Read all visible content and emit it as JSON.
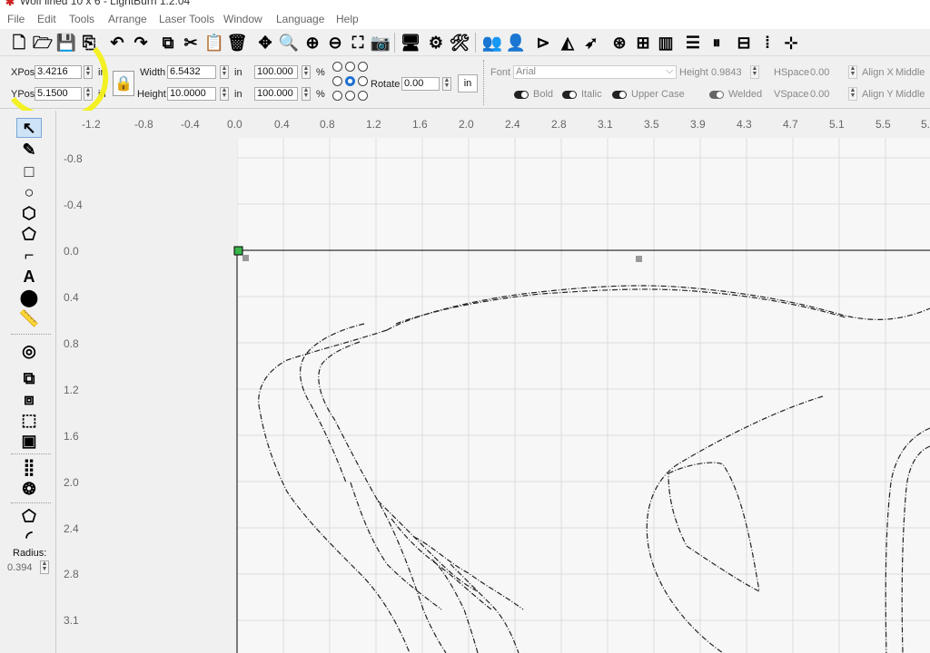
{
  "window": {
    "title": "Wolf lined 10 x 6 - LightBurn 1.2.04"
  },
  "menu": [
    "File",
    "Edit",
    "Tools",
    "Arrange",
    "Laser Tools",
    "Window",
    "Language",
    "Help"
  ],
  "toolbar_icons": [
    "new-file",
    "open-folder",
    "save",
    "save-as",
    "undo",
    "redo",
    "copy",
    "cut",
    "paste",
    "delete",
    "move",
    "zoom-in",
    "zoom-in",
    "zoom-out",
    "zoom-frame",
    "camera",
    "monitor",
    "settings",
    "tools",
    "group",
    "user",
    "mirror",
    "flip",
    "send",
    "target",
    "align",
    "distribute",
    "align-center",
    "align-middle",
    "dock",
    "distribute-grid"
  ],
  "props": {
    "xpos_label": "XPos",
    "xpos": "3.4216",
    "ypos_label": "YPos",
    "ypos": "5.1500",
    "unit": "in",
    "width_label": "Width",
    "width": "6.5432",
    "height_label": "Height",
    "height": "10.0000",
    "scale_w": "100.000",
    "scale_h": "100.000",
    "percent": "%",
    "rotate_label": "Rotate",
    "rotate": "0.00",
    "unit_btn": "in"
  },
  "text_props": {
    "font_label": "Font",
    "font": "Arial",
    "height_label": "Height",
    "height": "0.9843",
    "hspace_label": "HSpace",
    "hspace": "0.00",
    "vspace_label": "VSpace",
    "vspace": "0.00",
    "alignx_label": "Align X",
    "alignx": "Middle",
    "aligny_label": "Align Y",
    "aligny": "Middle",
    "bold": "Bold",
    "italic": "Italic",
    "upper": "Upper Case",
    "welded": "Welded"
  },
  "left_tools": [
    "select",
    "edit-nodes",
    "rectangle",
    "ellipse",
    "polygon",
    "pentagon",
    "frame",
    "text",
    "position",
    "measure",
    "offset",
    "boolean-union",
    "boolean-subtract",
    "boolean-intersect",
    "weld",
    "grid-array",
    "circular-array",
    "corner-radius",
    "corner-round"
  ],
  "radius": {
    "label": "Radius:",
    "value": "0.394"
  },
  "ruler_top": [
    "-1.2",
    "-0.8",
    "-0.4",
    "0.0",
    "0.4",
    "0.8",
    "1.2",
    "1.6",
    "2.0",
    "2.4",
    "2.8",
    "3.1",
    "3.5",
    "3.9",
    "4.3",
    "4.7",
    "5.1",
    "5.5",
    "5."
  ],
  "ruler_left": [
    "-0.8",
    "-0.4",
    "0.0",
    "0.4",
    "0.8",
    "1.2",
    "1.6",
    "2.0",
    "2.4",
    "2.8",
    "3.1"
  ],
  "colors": {
    "highlight": "#f4f21a",
    "accent": "#1f6fd1",
    "canvas": "#f7f7f7",
    "grid": "#dcdcdc"
  }
}
